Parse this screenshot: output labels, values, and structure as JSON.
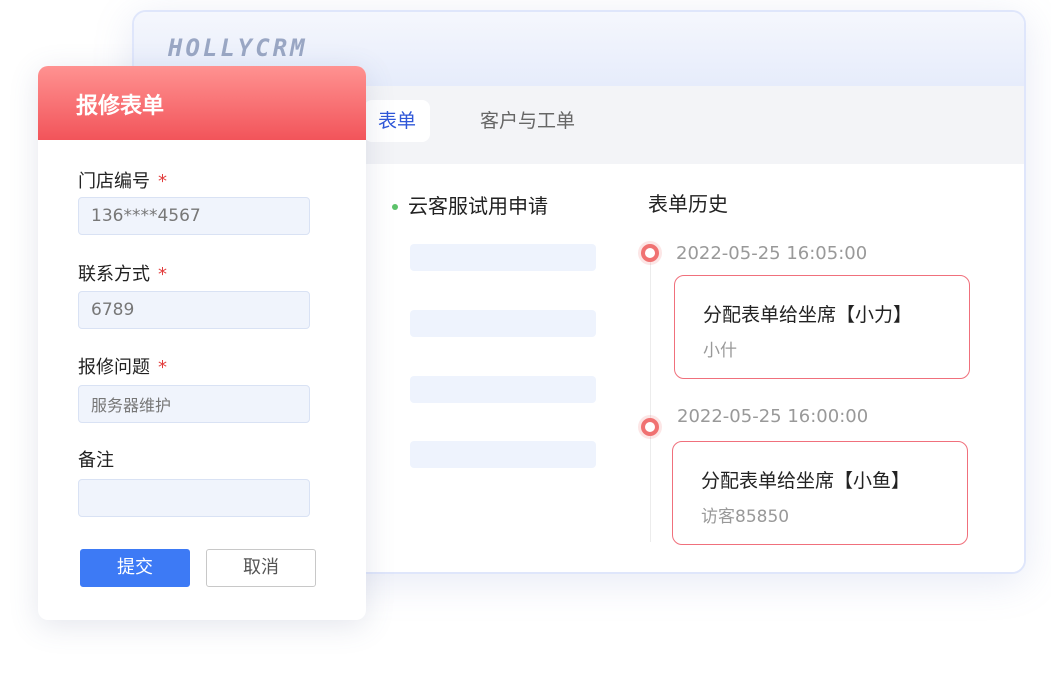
{
  "app": {
    "logo": "HOLLYCRM"
  },
  "tabs": [
    {
      "label": "表单",
      "active": true
    },
    {
      "label": "客户与工单",
      "active": false
    }
  ],
  "form_list": {
    "title": "云客服试用申请"
  },
  "history": {
    "title": "表单历史",
    "entries": [
      {
        "time": "2022-05-25 16:05:00",
        "action": "分配表单给坐席【小力】",
        "operator": "小什"
      },
      {
        "time": "2022-05-25 16:00:00",
        "action": "分配表单给坐席【小鱼】",
        "operator": "访客85850"
      }
    ]
  },
  "repair_form": {
    "title": "报修表单",
    "fields": [
      {
        "label": "门店编号",
        "required": true,
        "value": "136****4567"
      },
      {
        "label": "联系方式",
        "required": true,
        "value": "6789"
      },
      {
        "label": "报修问题",
        "required": true,
        "value": "服务器维护"
      },
      {
        "label": "备注",
        "required": false,
        "value": ""
      }
    ],
    "required_mark": "*",
    "submit_label": "提交",
    "cancel_label": "取消"
  },
  "colors": {
    "accent": "#3d7af5",
    "tab_active": "#2f57d8",
    "header_gradient_top": "#ff9291",
    "header_gradient_bottom": "#f2545a",
    "timeline_accent": "#f07272"
  }
}
